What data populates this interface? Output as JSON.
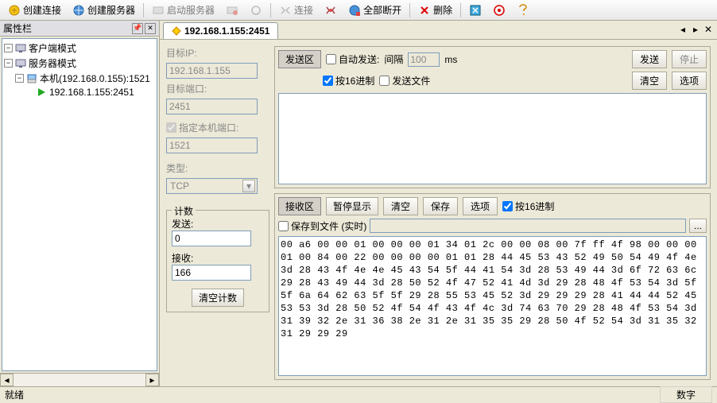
{
  "toolbar": {
    "create_connection": "创建连接",
    "create_server": "创建服务器",
    "start_server": "启动服务器",
    "connect": "连接",
    "disconnect_all": "全部断开",
    "delete": "删除"
  },
  "left_panel": {
    "title": "属性栏",
    "tree": {
      "client_mode": "客户端模式",
      "server_mode": "服务器模式",
      "local_machine": "本机(192.168.0.155):1521",
      "connection": "192.168.1.155:2451"
    }
  },
  "tab": {
    "title": "192.168.1.155:2451"
  },
  "form": {
    "target_ip_label": "目标IP:",
    "target_ip_value": "192.168.1.155",
    "target_port_label": "目标端口:",
    "target_port_value": "2451",
    "local_port_label": "指定本机端口:",
    "local_port_value": "1521",
    "type_label": "类型:",
    "type_value": "TCP",
    "count_group": "计数",
    "send_count_label": "发送:",
    "send_count_value": "0",
    "recv_count_label": "接收:",
    "recv_count_value": "166",
    "clear_count_btn": "清空计数"
  },
  "send": {
    "area_btn": "发送区",
    "auto_send": "自动发送:",
    "interval_label": "间隔",
    "interval_value": "100",
    "interval_unit": "ms",
    "send_btn": "发送",
    "stop_btn": "停止",
    "hex_chk": "按16进制",
    "send_file_chk": "发送文件",
    "clear_btn": "清空",
    "options_btn": "选项"
  },
  "recv": {
    "area_btn": "接收区",
    "pause_btn": "暂停显示",
    "clear_btn": "清空",
    "save_btn": "保存",
    "options_btn": "选项",
    "hex_chk": "按16进制",
    "save_to_file": "保存到文件 (实时)",
    "hex_data": "00 a6 00 00 01 00 00 00 01 34 01 2c 00 00 08 00 7f ff 4f 98 00 00 00 01 00 84 00 22 00 00 00 00 01 01 28 44 45 53 43 52 49 50 54 49 4f 4e 3d 28 43 4f 4e 4e 45 43 54 5f 44 41 54 3d 28 53 49 44 3d 6f 72 63 6c 29 28 43 49 44 3d 28 50 52 4f 47 52 41 4d 3d 29 28 48 4f 53 54 3d 5f 5f 6a 64 62 63 5f 5f 29 28 55 53 45 52 3d 29 29 29 28 41 44 44 52 45 53 53 3d 28 50 52 4f 54 4f 43 4f 4c 3d 74 63 70 29 28 48 4f 53 54 3d 31 39 32 2e 31 36 38 2e 31 2e 31 35 35 29 28 50 4f 52 54 3d 31 35 32 31 29 29 29"
  },
  "statusbar": {
    "ready": "就绪",
    "num": "数字"
  }
}
